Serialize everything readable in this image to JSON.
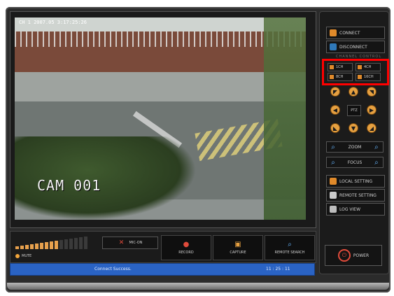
{
  "video": {
    "timestamp": "CH 1 2007.05 3:17:25:26",
    "camera_label": "CAM 001"
  },
  "right_panel": {
    "connect": "CONNECT",
    "disconnect": "DISCONNECT",
    "section_label": "CHANNEL CONTROL",
    "channels": [
      "1CH",
      "4CH",
      "8CH",
      "16CH"
    ],
    "ptz_center": "PTZ",
    "zoom": "ZOOM",
    "focus": "FOCUS",
    "local_setting": "LOCAL SETTING",
    "remote_setting": "REMOTE SETTING",
    "log_view": "LOG VIEW",
    "power": "POWER"
  },
  "bottom_bar": {
    "mute": "MUTE",
    "mic": "MIC-ON",
    "record": "RECORD",
    "capture": "CAPTURE",
    "remote_search": "REMOTE SEARCH"
  },
  "status_bar": {
    "message": "Connect Success.",
    "time": "11 : 25 : 11"
  },
  "audio_level": {
    "active_segments": 9,
    "total_segments": 15
  },
  "icons": {
    "connect": "plug-icon",
    "disconnect": "unplug-icon",
    "ptz_arrows": [
      "up-left-icon",
      "up-icon",
      "up-right-icon",
      "left-icon",
      "right-icon",
      "down-left-icon",
      "down-icon",
      "down-right-icon"
    ],
    "zoom": [
      "zoom-out-icon",
      "zoom-in-icon"
    ],
    "focus": [
      "focus-out-icon",
      "focus-in-icon"
    ],
    "power": "power-icon",
    "record": "record-icon",
    "capture": "camera-icon",
    "remote_search": "search-icon",
    "mic": "mic-off-icon",
    "mute": "speaker-icon"
  },
  "colors": {
    "accent": "#E6A040",
    "highlight": "#FF0000",
    "status_bar": "#2A63C4",
    "power": "#E04B3B"
  }
}
